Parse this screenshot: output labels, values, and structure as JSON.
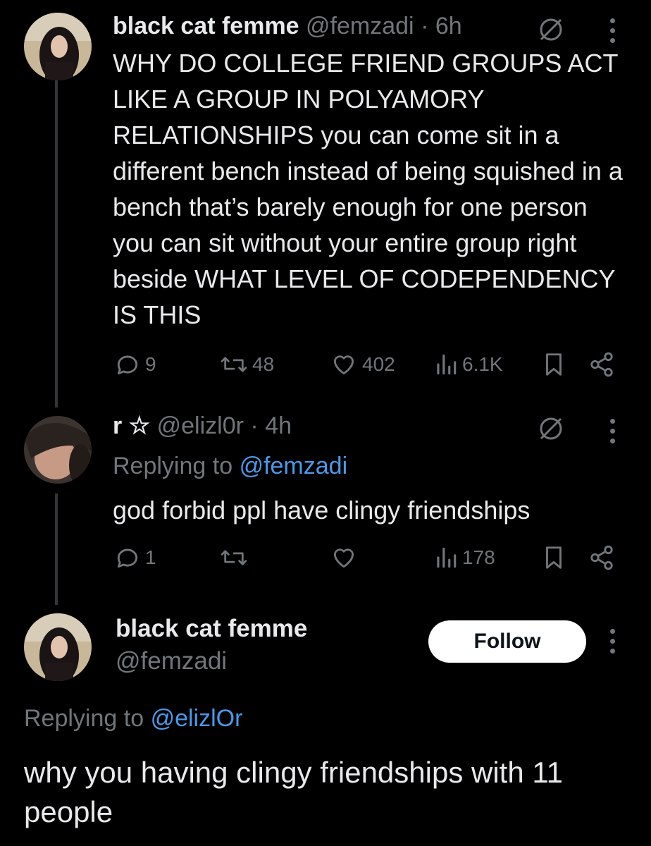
{
  "tweet1": {
    "name": "black cat femme",
    "handle": "@femzadi",
    "sep": "·",
    "time": "6h",
    "text": "WHY DO COLLEGE FRIEND GROUPS ACT LIKE A GROUP IN POLYAMORY RELATIONSHIPS you can come sit in a different bench instead of being squished in a bench that’s barely enough for one person you can sit without your entire group right beside WHAT LEVEL OF CODEPENDENCY IS THIS",
    "replies": "9",
    "retweets": "48",
    "likes": "402",
    "views": "6.1K"
  },
  "tweet2": {
    "name": "r ☆",
    "handle": "@elizl0r",
    "sep": "·",
    "time": "4h",
    "replying_prefix": "Replying to",
    "replying_handle": "@femzadi",
    "text": "god forbid ppl have clingy friendships",
    "replies": "1",
    "views": "178"
  },
  "tweet3": {
    "name": "black cat femme",
    "handle": "@femzadi",
    "follow_label": "Follow",
    "replying_prefix": "Replying to",
    "replying_handle": "@elizlOr",
    "text": "why you having clingy friendships with 11 people"
  },
  "colors": {
    "background": "#000000",
    "text": "#e7e9ea",
    "secondary": "#71767b",
    "link": "#4a99e9",
    "thread_line": "#333639"
  },
  "icons": [
    "reply-icon",
    "retweet-icon",
    "like-icon",
    "views-icon",
    "bookmark-icon",
    "share-icon",
    "muted-icon",
    "more-icon"
  ]
}
